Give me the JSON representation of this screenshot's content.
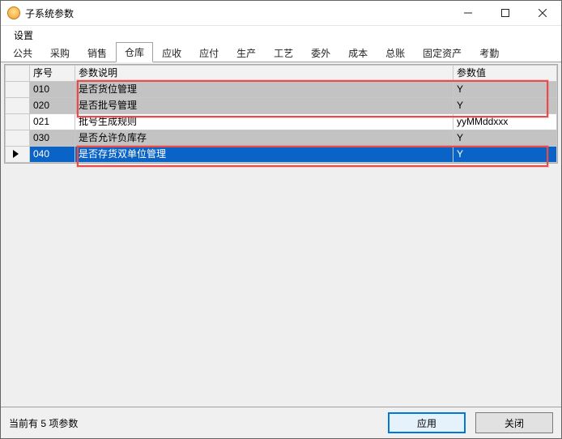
{
  "window": {
    "title": "子系统参数"
  },
  "menubar": {
    "items": [
      "设置"
    ]
  },
  "tabs": {
    "items": [
      "公共",
      "采购",
      "销售",
      "仓库",
      "应收",
      "应付",
      "生产",
      "工艺",
      "委外",
      "成本",
      "总账",
      "固定资产",
      "考勤"
    ],
    "activeIndex": 3
  },
  "grid": {
    "columns": {
      "rowhdr": "",
      "serial": "序号",
      "desc": "参数说明",
      "value": "参数值"
    },
    "rows": [
      {
        "serial": "010",
        "desc": "是否货位管理",
        "value": "Y",
        "shaded": true
      },
      {
        "serial": "020",
        "desc": "是否批号管理",
        "value": "Y",
        "shaded": true
      },
      {
        "serial": "021",
        "desc": "批号生成规则",
        "value": "yyMMddxxx",
        "shaded": false
      },
      {
        "serial": "030",
        "desc": "是否允许负库存",
        "value": "Y",
        "shaded": true
      },
      {
        "serial": "040",
        "desc": "是否存货双单位管理",
        "value": "Y",
        "shaded": false,
        "selected": true
      }
    ]
  },
  "footer": {
    "status": "当前有 5 项参数",
    "apply": "应用",
    "close": "关闭"
  }
}
